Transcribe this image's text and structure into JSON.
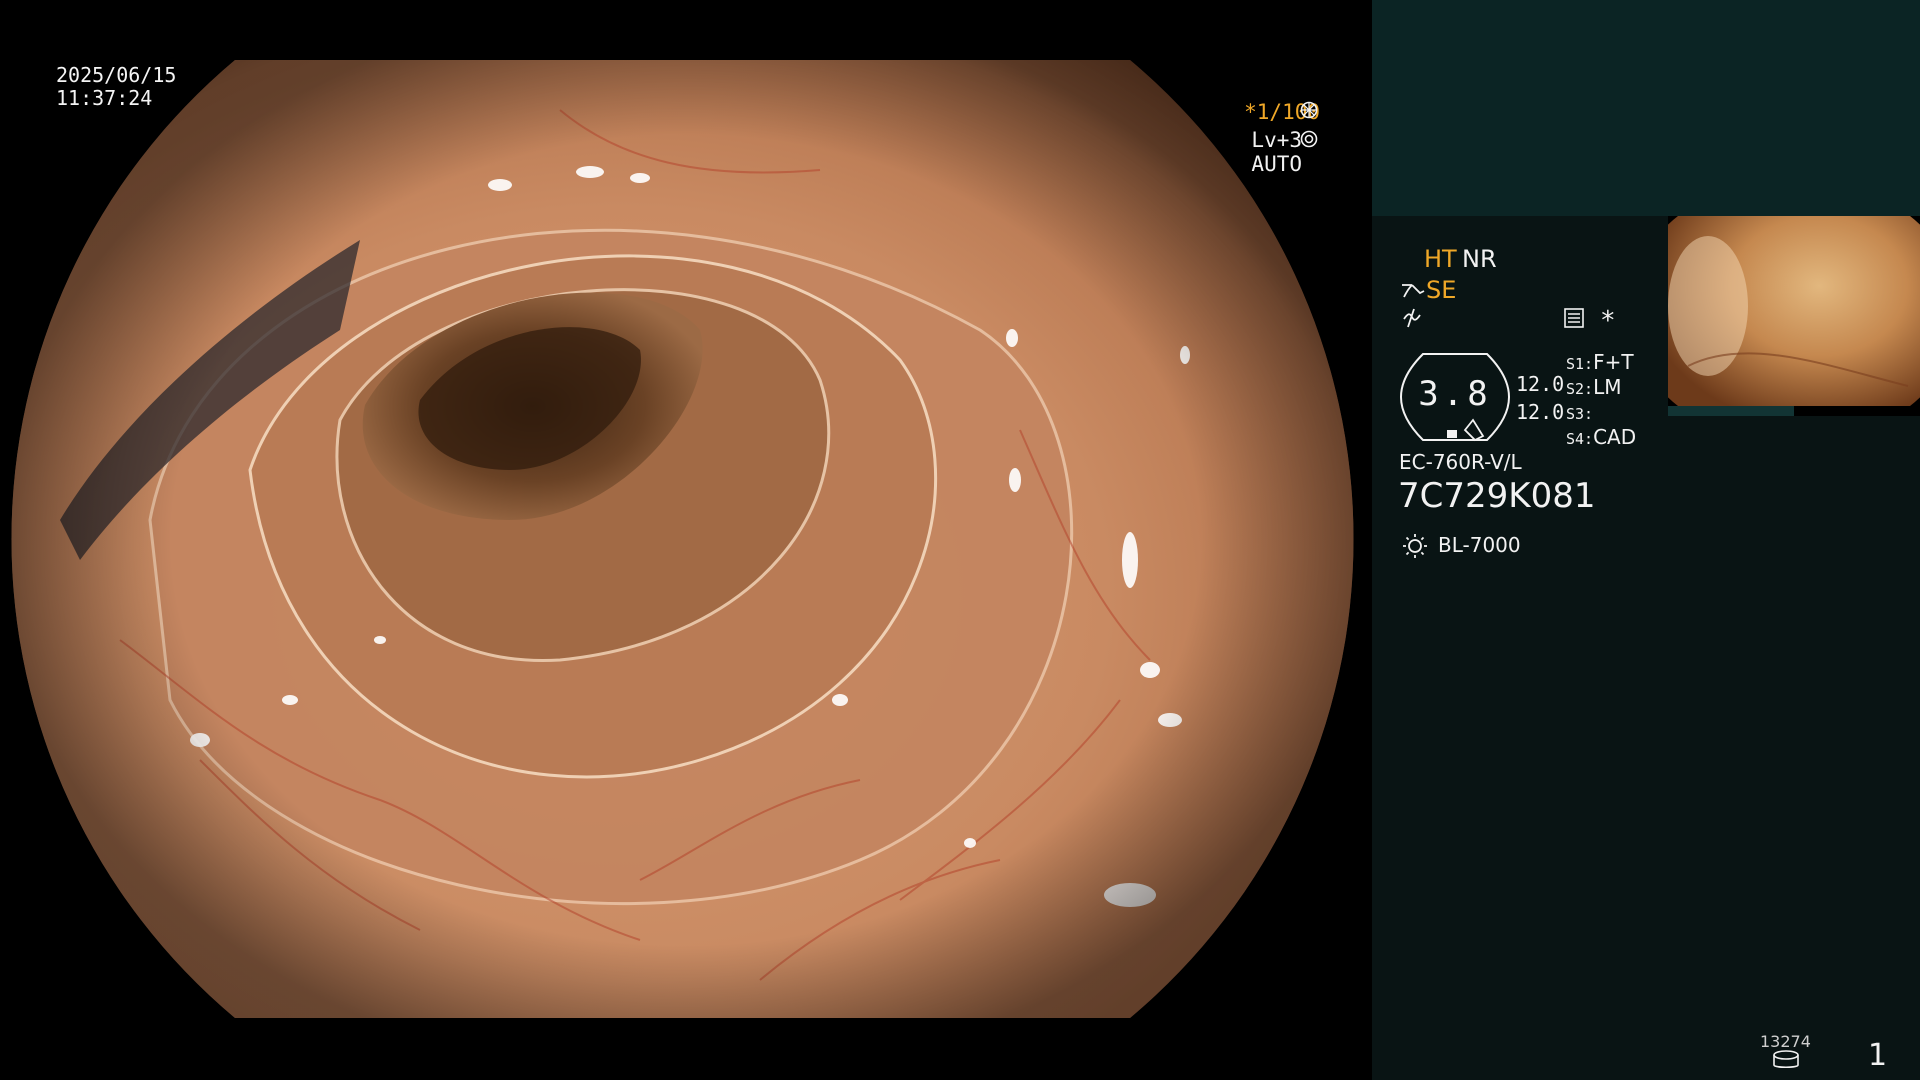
{
  "overlay": {
    "date": "2025/06/15",
    "time": "11:37:24",
    "shutter_speed": "*1/100",
    "level_mode": "Lv+3 AUTO"
  },
  "panel": {
    "mode_ht": "HT",
    "mode_nr": "NR",
    "mode_se": "SE",
    "zoom": "3.8",
    "value_a": "12.0",
    "value_b": "12.0",
    "switches": [
      {
        "label": "S1:",
        "value": "F+T"
      },
      {
        "label": "S2:",
        "value": "LM"
      },
      {
        "label": "S3:",
        "value": ""
      },
      {
        "label": "S4:",
        "value": "CAD"
      }
    ],
    "scope_model": "EC-760R-V/L",
    "serial": "7C729K081",
    "light_source": "BL-7000",
    "image_count": "13274",
    "page": "1"
  },
  "colors": {
    "accent_orange": "#f0a828",
    "panel_bg": "#091414",
    "panel_top_bg": "#0b2424",
    "mucosa": "#c98a62"
  },
  "icons": [
    "shutter-icon",
    "auto-level-icon",
    "se-icon",
    "freeze-icon",
    "menu-icon",
    "star-icon",
    "light-source-icon",
    "storage-icon"
  ]
}
